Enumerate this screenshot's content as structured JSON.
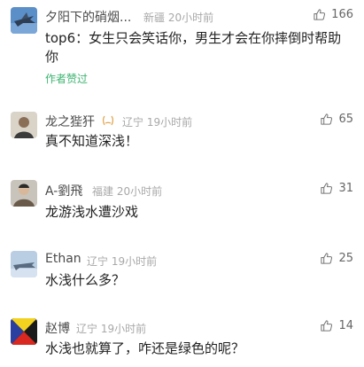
{
  "comments": [
    {
      "name": "夕阳下的硝烟...",
      "location": "新疆",
      "time": "20小时前",
      "likes": "166",
      "text": "top6：女生只会笑话你，男生才会在你摔倒时帮助你",
      "tag": "作者赞过",
      "avatar_icon": "fighter-jet-avatar"
    },
    {
      "name": "龙之狴犴",
      "location": "辽宁",
      "time": "19小时前",
      "likes": "65",
      "text": "真不知道深浅！",
      "avatar_icon": "person-photo-avatar",
      "badge_icon": "wheat-badge-icon"
    },
    {
      "name": "A-劉飛",
      "location": "福建",
      "time": "20小时前",
      "likes": "31",
      "text": "龙游浅水遭沙戏",
      "avatar_icon": "person-photo-avatar"
    },
    {
      "name": "Ethan",
      "location": "辽宁",
      "time": "19小时前",
      "likes": "25",
      "text": "水浅什么多？",
      "avatar_icon": "aircraft-avatar"
    },
    {
      "name": "赵博",
      "location": "辽宁",
      "time": "19小时前",
      "likes": "14",
      "text": "水浅也就算了，咋还是绿色的呢？",
      "avatar_icon": "flag-avatar"
    }
  ],
  "colors": {
    "author_liked": "#3cb371",
    "meta": "#a8a8a8",
    "text": "#222222"
  }
}
